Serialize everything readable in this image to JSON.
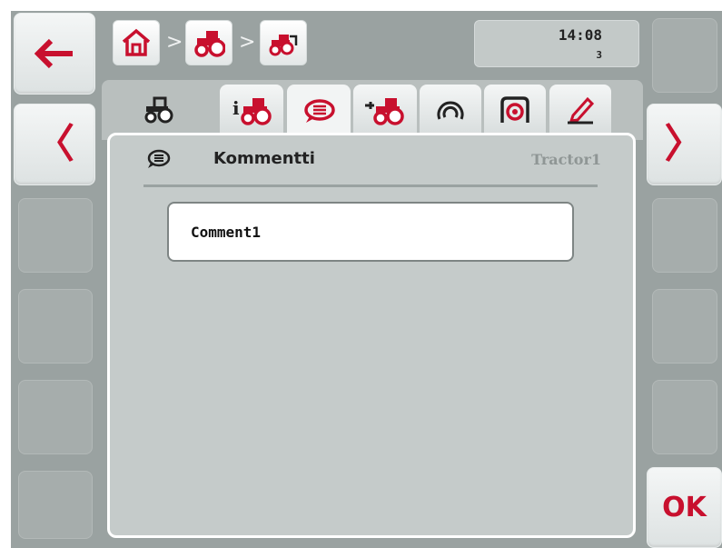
{
  "breadcrumb": {
    "items": [
      "home",
      "tractor",
      "tractor-2"
    ],
    "separator": ">"
  },
  "status": {
    "time": "14:08",
    "count": "3"
  },
  "tabs": [
    {
      "name": "tractor",
      "icon": "tractor-icon"
    },
    {
      "name": "info",
      "icon": "info-tractor-icon"
    },
    {
      "name": "comments",
      "icon": "comment-icon",
      "active": true
    },
    {
      "name": "hitch",
      "icon": "hitch-tractor-icon"
    },
    {
      "name": "speed",
      "icon": "speed-sensor-icon"
    },
    {
      "name": "pto",
      "icon": "pto-icon"
    },
    {
      "name": "edit",
      "icon": "pencil-icon"
    }
  ],
  "panel": {
    "title": "Kommentti",
    "object": "Tractor1"
  },
  "comments": [
    "Comment1"
  ],
  "softkeys": {
    "ok_label": "OK"
  },
  "colors": {
    "accent": "#c8102e",
    "background": "#9aa2a1",
    "panel": "#c5cbca"
  }
}
